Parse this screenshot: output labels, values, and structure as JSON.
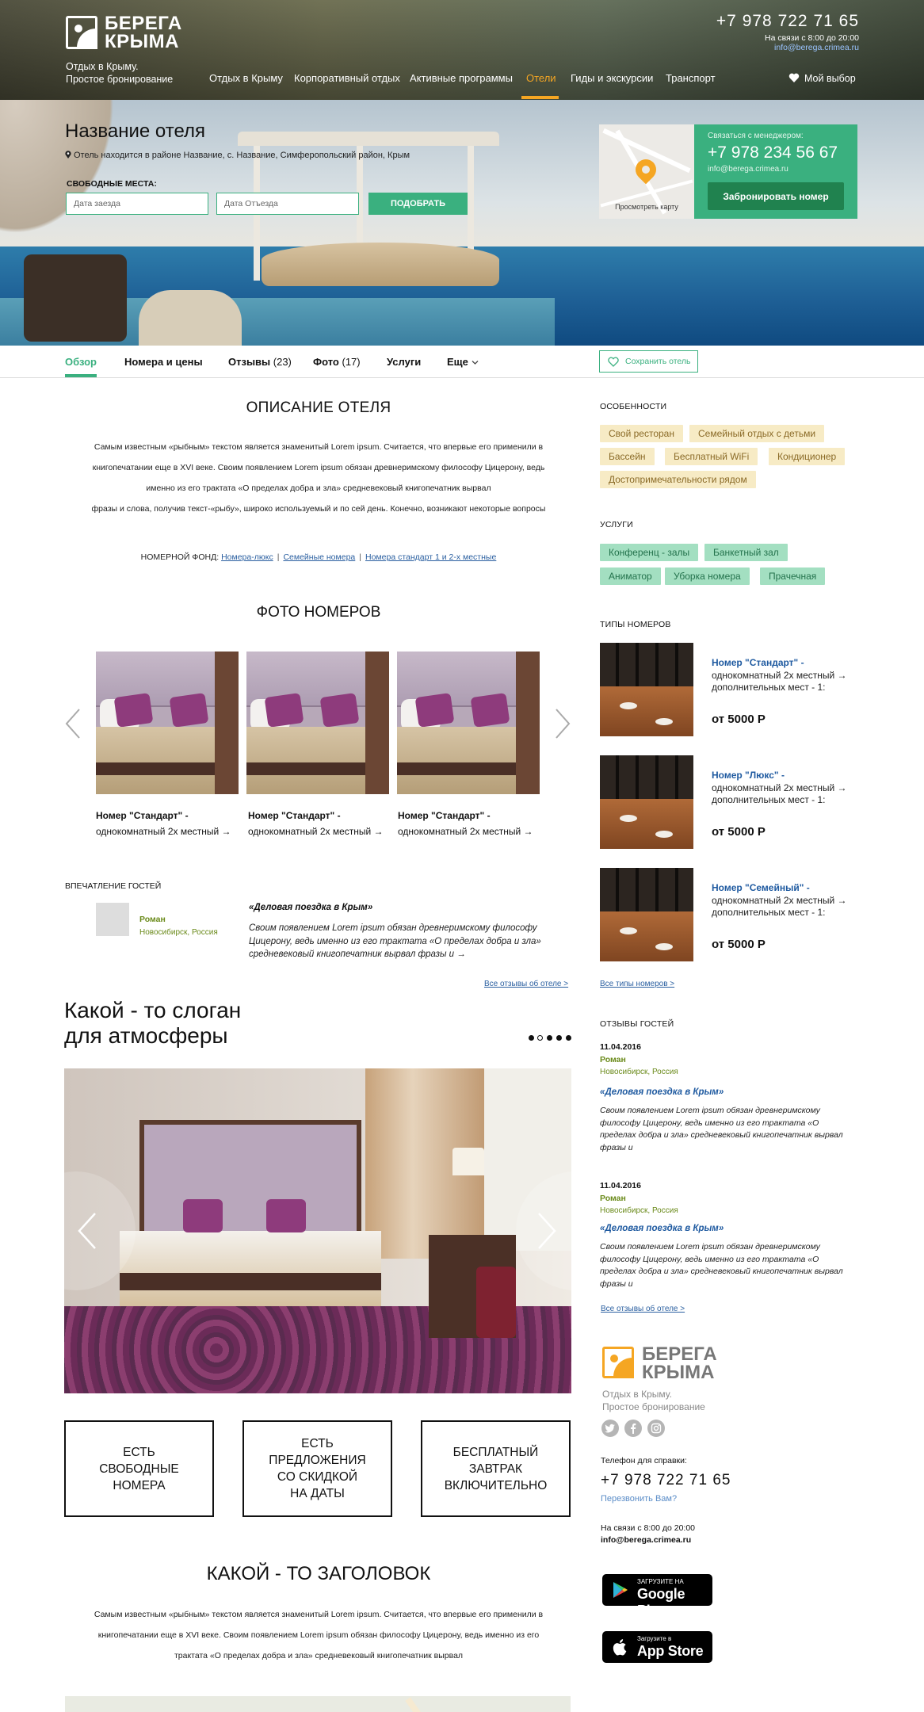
{
  "header": {
    "logo_line1": "БЕРЕГА",
    "logo_line2": "КРЫМА",
    "tagline1": "Отдых в Крыму.",
    "tagline2": "Простое бронирование",
    "nav": [
      "Отдых в Крыму",
      "Корпоративный отдых",
      "Активные программы",
      "Отели",
      "Гиды и экскурсии",
      "Транспорт"
    ],
    "active_nav": "Отели",
    "phone": "+7 978 722 71 65",
    "hours": "На связи с 8:00 до 20:00",
    "email": "info@berega.crimea.ru",
    "my_choice": "Мой выбор"
  },
  "hero": {
    "hotel_name": "Название отеля",
    "address": "Отель находится в районе Название, с. Название, Симферопольский район, Крым",
    "free_places_label": "СВОБОДНЫЕ МЕСТА:",
    "date_in_placeholder": "Дата заезда",
    "date_out_placeholder": "Дата Отъезда",
    "pick_button": "ПОДОБРАТЬ",
    "map_caption": "Просмотреть карту",
    "manager_title": "Связаться с менеджером:",
    "manager_phone": "+7 978 234 56 67",
    "manager_email": "info@berega.crimea.ru",
    "book_button": "Забронировать номер"
  },
  "tabs": [
    {
      "label": "Обзор",
      "count": ""
    },
    {
      "label": "Номера и цены",
      "count": ""
    },
    {
      "label": "Отзывы",
      "count": "(23)"
    },
    {
      "label": "Фото",
      "count": "(17)"
    },
    {
      "label": "Услуги",
      "count": ""
    },
    {
      "label": "Еще",
      "count": ""
    }
  ],
  "save_hotel": "Сохранить отель",
  "description": {
    "title": "ОПИСАНИЕ ОТЕЛЯ",
    "lines": [
      "Самым известным «рыбным» текстом является знаменитый Lorem ipsum. Считается, что впервые его применили в",
      "книгопечатании еще в XVI веке. Своим появлением Lorem ipsum обязан древнеримскому философу Цицерону, ведь",
      "именно из его трактата «О пределах добра и зла» средневековый книгопечатник вырвал",
      "фразы и слова, получив текст-«рыбу», широко используемый и по сей день. Конечно, возникают некоторые вопросы"
    ],
    "room_fund_label": "НОМЕРНОЙ ФОНД:",
    "room_fund_links": [
      "Номера-люкс",
      "Семейные номера",
      "Номера стандарт 1 и 2-х местные"
    ]
  },
  "photos": {
    "title": "ФОТО НОМЕРОВ",
    "rooms": [
      {
        "title": "Номер \"Стандарт\" -",
        "sub": "однокомнатный 2х местный →"
      },
      {
        "title": "Номер \"Стандарт\" -",
        "sub": "однокомнатный 2х местный →"
      },
      {
        "title": "Номер \"Стандарт\" -",
        "sub": "однокомнатный 2х местный →"
      }
    ]
  },
  "impressions": {
    "label": "ВПЕЧАТЛЕНИЕ ГОСТЕЙ",
    "name": "Роман",
    "city": "Новосибирск, Россия",
    "quote_title": "«Деловая поездка в Крым»",
    "quote": "Своим появлением Lorem ipsum обязан древнеримскому философу Цицерону, ведь именно из его трактата «О пределах добра и зла» средневековый книгопечатник вырвал фразы и →",
    "all_reviews": "Все отзывы об отеле >"
  },
  "slogan": {
    "line1": "Какой - то слоган",
    "line2": "для атмосферы"
  },
  "features": [
    "ЕСТЬ\nСВОБОДНЫЕ\nНОМЕРА",
    "ЕСТЬ\nПРЕДЛОЖЕНИЯ\nСО СКИДКОЙ\nНА ДАТЫ",
    "БЕСПЛАТНЫЙ\nЗАВТРАК\nВКЛЮЧИТЕЛЬНО"
  ],
  "heading_block": {
    "title": "КАКОЙ - ТО ЗАГОЛОВОК",
    "lines": [
      "Самым известным «рыбным» текстом является знаменитый Lorem ipsum. Считается, что впервые его применили в",
      "книгопечатании еще в XVI веке. Своим появлением Lorem ipsum обязан философу Цицерону, ведь именно из его",
      "трактата «О пределах добра и зла» средневековый книгопечатник вырвал"
    ]
  },
  "sidebar": {
    "features_label": "ОСОБЕННОСТИ",
    "features": [
      "Свой ресторан",
      "Семейный отдых с детьми",
      "Бассейн",
      "Бесплатный WiFi",
      "Кондиционер",
      "Достопримечательности рядом"
    ],
    "services_label": "УСЛУГИ",
    "services": [
      "Конференц - залы",
      "Банкетный зал",
      "Аниматор",
      "Уборка номера",
      "Прачечная"
    ],
    "room_types_label": "ТИПЫ НОМЕРОВ",
    "room_types": [
      {
        "title": "Номер \"Стандарт\" -",
        "line1": "однокомнатный 2х местный →",
        "line2": "дополнительных мест - 1:",
        "price": "от 5000 Р"
      },
      {
        "title": "Номер \"Люкс\" -",
        "line1": "однокомнатный 2х местный →",
        "line2": "дополнительных мест - 1:",
        "price": "от 5000 Р"
      },
      {
        "title": "Номер \"Семейный\" -",
        "line1": "однокомнатный 2х местный →",
        "line2": "дополнительных мест - 1:",
        "price": "от 5000 Р"
      }
    ],
    "all_types": "Все типы номеров >",
    "reviews_label": "ОТЗЫВЫ ГОСТЕЙ",
    "reviews": [
      {
        "date": "11.04.2016",
        "name": "Роман",
        "city": "Новосибирск, Россия",
        "title": "«Деловая поездка в Крым»",
        "text": "Своим появлением Lorem ipsum обязан древнеримскому философу Цицерону, ведь именно из его трактата «О пределах добра и зла» средневековый книгопечатник вырвал фразы и"
      },
      {
        "date": "11.04.2016",
        "name": "Роман",
        "city": "Новосибирск, Россия",
        "title": "«Деловая поездка в Крым»",
        "text": "Своим появлением Lorem ipsum обязан древнеримскому философу Цицерону, ведь именно из его трактата «О пределах добра и зла» средневековый книгопечатник вырвал фразы и"
      }
    ],
    "all_reviews": "Все отзывы об отеле >"
  },
  "footer": {
    "logo_line1": "БЕРЕГА",
    "logo_line2": "КРЫМА",
    "tagline1": "Отдых в Крыму.",
    "tagline2": "Простое бронирование",
    "phone_label": "Телефон для справки:",
    "phone": "+7 978 722 71 65",
    "callback": "Перезвонить Вам?",
    "hours": "На связи с 8:00 до 20:00",
    "email": "info@berega.crimea.ru",
    "google_small": "ЗАГРУЗИТЕ НА",
    "google_big": "Google Play",
    "apple_small": "Загрузите в",
    "apple_big": "App Store"
  },
  "colors": {
    "accent_green": "#3ab07f",
    "accent_orange": "#f5a623",
    "link_blue": "#2a5fa0"
  }
}
